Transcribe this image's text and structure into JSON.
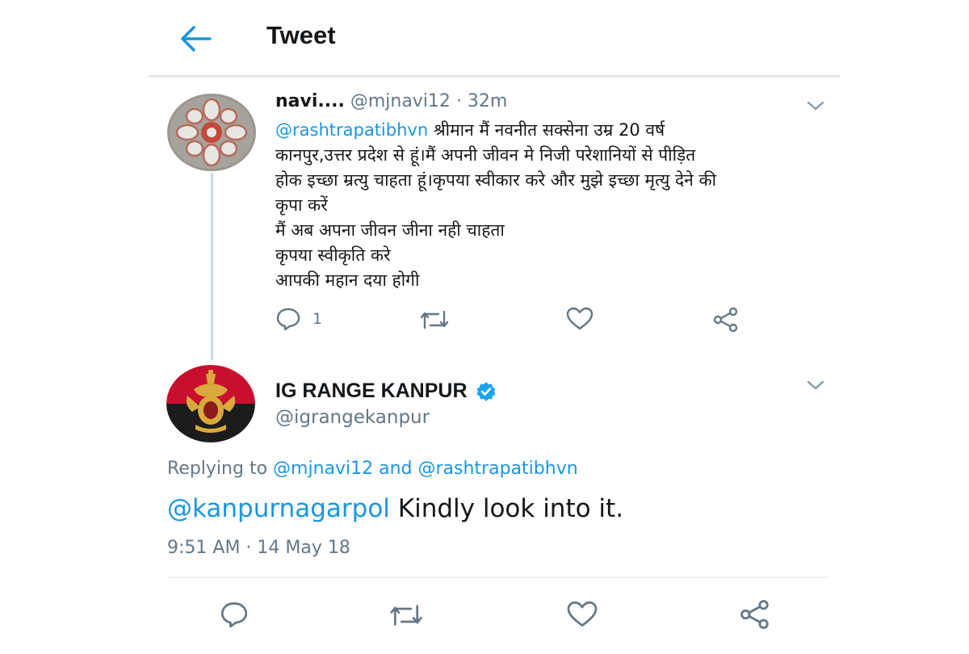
{
  "header": {
    "title": "Tweet",
    "back_icon": "back-arrow-icon"
  },
  "parent_tweet": {
    "display_name": "navi....",
    "handle": "@mjnavi12",
    "separator": " · ",
    "age": "32m",
    "mention": "@rashtrapatibhvn",
    "text_first_line_rest": " श्रीमान मैं नवनीत सक्सेना उम्र 20 वर्ष",
    "text_lines": [
      "कानपुर,उत्तर प्रदेश से हूं।मैं अपनी जीवन मे निजी परेशानियों से पीड़ित",
      "होक इच्छा म्रत्यु चाहता हूं।कृपया स्वीकार करे और मुझे इच्छा मृत्यु देने की",
      "कृपा करें",
      "मैं अब अपना जीवन जीना नही चाहता",
      "कृपया स्वीकृति करे",
      "आपकी महान दया होगी"
    ],
    "reply_count": "1"
  },
  "main_tweet": {
    "display_name": "IG RANGE KANPUR",
    "handle": "@igrangekanpur",
    "replying_prefix": "Replying to ",
    "replying_user1": "@mjnavi12",
    "replying_and": " and ",
    "replying_user2": "@rashtrapatibhvn",
    "body_mention": "@kanpurnagarpol",
    "body_text": " Kindly look into it.",
    "timestamp": "9:51 AM · 14 May 18"
  },
  "colors": {
    "accent": "#1b95e0",
    "secondary_text": "#657786",
    "primary_text": "#14171a",
    "divider": "#e3e7ea"
  }
}
